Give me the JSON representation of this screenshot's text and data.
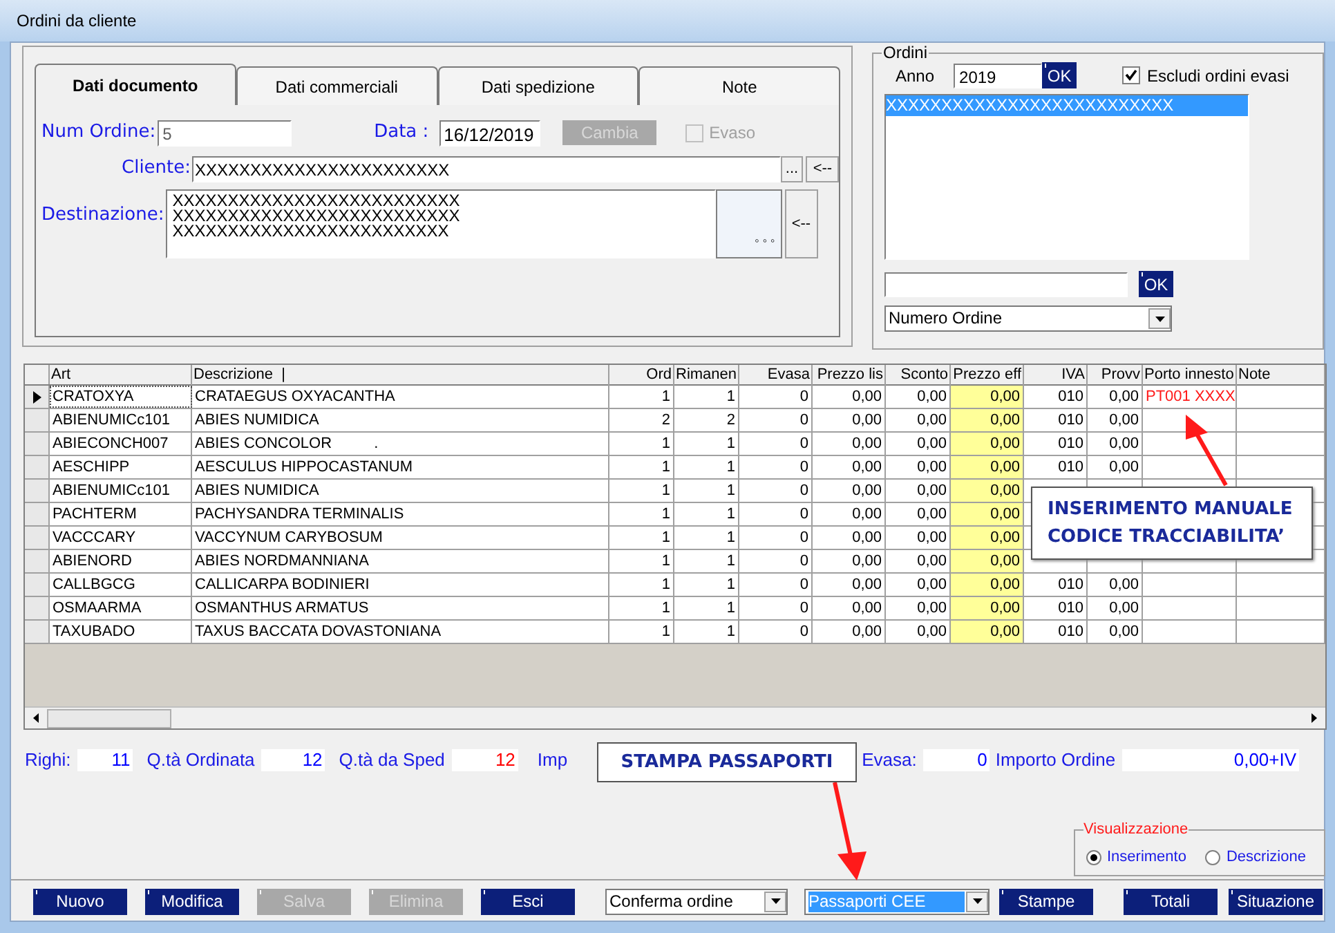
{
  "window": {
    "title": "Ordini da cliente"
  },
  "tabs": [
    {
      "label": "Dati documento",
      "selected": true
    },
    {
      "label": "Dati commerciali",
      "selected": false
    },
    {
      "label": "Dati spedizione",
      "selected": false
    },
    {
      "label": "Note",
      "selected": false
    }
  ],
  "document": {
    "num_ordine_label": "Num Ordine:",
    "num_ordine": "5",
    "data_label": "Data :",
    "data": "16/12/2019",
    "cambia_button": {
      "label": "Cambia",
      "disabled": true
    },
    "evaso": {
      "label": "Evaso",
      "checked": false,
      "disabled": true
    },
    "cliente_label": "Cliente:",
    "cliente": "XXXXXXXXXXXXXXXXXXXXXXX",
    "cliente_browse": "...",
    "cliente_back": "<--",
    "destinazione_label": "Destinazione:",
    "destinazione_lines": [
      "XXXXXXXXXXXXXXXXXXXXXXXXXX",
      "XXXXXXXXXXXXXXXXXXXXXXXXXX",
      "XXXXXXXXXXXXXXXXXXXXXXXXX"
    ],
    "destinazione_browse": "◦ ◦ ◦",
    "destinazione_back": "<--"
  },
  "ordini": {
    "title": "Ordini",
    "anno_label": "Anno",
    "anno": "2019",
    "anno_ok": "OK",
    "escludi": {
      "label": "Escludi ordini evasi",
      "checked": true
    },
    "list": [
      {
        "text": "XXXXXXXXXXXXXXXXXXXXXXXXXX",
        "selected": true
      }
    ],
    "search_ok": "OK",
    "sort": "Numero Ordine"
  },
  "grid": {
    "columns": [
      {
        "label": "Art",
        "highlighted": false
      },
      {
        "label": "Descrizione  |",
        "highlighted": false
      },
      {
        "label": "Ord",
        "highlighted": false
      },
      {
        "label": "Rimanen",
        "highlighted": false
      },
      {
        "label": "Evasa",
        "highlighted": false
      },
      {
        "label": "Prezzo lis",
        "highlighted": false
      },
      {
        "label": "Sconto",
        "highlighted": false
      },
      {
        "label": "Prezzo eff",
        "highlighted": true
      },
      {
        "label": "IVA",
        "highlighted": false
      },
      {
        "label": "Provv",
        "highlighted": false
      },
      {
        "label": "Porto innesto",
        "highlighted": false
      },
      {
        "label": "Note",
        "highlighted": false
      }
    ],
    "rows": [
      {
        "current": true,
        "cells": [
          "CRATOXYA",
          "CRATAEGUS OXYACANTHA",
          "1",
          "1",
          "0",
          "0,00",
          "0,00",
          "0,00",
          "010",
          "0,00",
          "PT001 XXXX"
        ]
      },
      {
        "current": false,
        "cells": [
          "ABIENUMICc101",
          "ABIES NUMIDICA",
          "2",
          "2",
          "0",
          "0,00",
          "0,00",
          "0,00",
          "010",
          "0,00"
        ]
      },
      {
        "current": false,
        "cells": [
          "ABIECONCH007",
          "ABIES CONCOLOR          .",
          "1",
          "1",
          "0",
          "0,00",
          "0,00",
          "0,00",
          "010",
          "0,00"
        ]
      },
      {
        "current": false,
        "cells": [
          "AESCHIPP",
          "AESCULUS HIPPOCASTANUM",
          "1",
          "1",
          "0",
          "0,00",
          "0,00",
          "0,00",
          "010",
          "0,00"
        ]
      },
      {
        "current": false,
        "cells": [
          "ABIENUMICc101",
          "ABIES NUMIDICA",
          "1",
          "1",
          "0",
          "0,00",
          "0,00",
          "0,00"
        ]
      },
      {
        "current": false,
        "cells": [
          "PACHTERM",
          "PACHYSANDRA TERMINALIS",
          "1",
          "1",
          "0",
          "0,00",
          "0,00",
          "0,00"
        ]
      },
      {
        "current": false,
        "cells": [
          "VACCCARY",
          "VACCYNUM CARYBOSUM",
          "1",
          "1",
          "0",
          "0,00",
          "0,00",
          "0,00"
        ]
      },
      {
        "current": false,
        "cells": [
          "ABIENORD",
          "ABIES NORDMANNIANA",
          "1",
          "1",
          "0",
          "0,00",
          "0,00",
          "0,00"
        ]
      },
      {
        "current": false,
        "cells": [
          "CALLBGCG",
          "CALLICARPA BODINIERI",
          "1",
          "1",
          "0",
          "0,00",
          "0,00",
          "0,00",
          "010",
          "0,00"
        ]
      },
      {
        "current": false,
        "cells": [
          "OSMAARMA",
          "OSMANTHUS ARMATUS",
          "1",
          "1",
          "0",
          "0,00",
          "0,00",
          "0,00",
          "010",
          "0,00"
        ]
      },
      {
        "current": false,
        "cells": [
          "TAXUBADO",
          "TAXUS BACCATA DOVASTONIANA",
          "1",
          "1",
          "0",
          "0,00",
          "0,00",
          "0,00",
          "010",
          "0,00"
        ]
      }
    ]
  },
  "totals": [
    {
      "label": "Righi:",
      "value": "11",
      "color": "#0000ff"
    },
    {
      "label": "Q.tà Ordinata",
      "value": "12",
      "color": "#0000ff"
    },
    {
      "label": "Q.tà da Sped",
      "value": "12",
      "color": "#ff0000"
    },
    {
      "label": "Imp"
    },
    {
      "label": "Evasa:",
      "value": "0",
      "color": "#0000ff"
    },
    {
      "label": "Importo Ordine",
      "value": "0,00+IV",
      "color": "#0000ff"
    }
  ],
  "visualizzazione": {
    "title": "Visualizzazione",
    "options": [
      {
        "label": "Inserimento",
        "selected": true
      },
      {
        "label": "Descrizione",
        "selected": false
      }
    ]
  },
  "toolbar": [
    {
      "kind": "button",
      "label": "Nuovo",
      "disabled": false
    },
    {
      "kind": "button",
      "label": "Modifica",
      "disabled": false
    },
    {
      "kind": "button",
      "label": "Salva",
      "disabled": true
    },
    {
      "kind": "button",
      "label": "Elimina",
      "disabled": true
    },
    {
      "kind": "button",
      "label": "Esci",
      "disabled": false
    },
    {
      "kind": "combo",
      "label": "Conferma ordine",
      "focused": false
    },
    {
      "kind": "combo",
      "label": "Passaporti CEE",
      "focused": true
    },
    {
      "kind": "button",
      "label": "Stampe",
      "disabled": false
    },
    {
      "kind": "button",
      "label": "Totali",
      "disabled": false
    },
    {
      "kind": "button",
      "label": "Situazione",
      "disabled": false
    }
  ],
  "callouts": [
    {
      "text": "INSERIMENTO MANUALE CODICE TRACCIABILITA’"
    },
    {
      "text": "STAMPA PASSAPORTI"
    }
  ]
}
